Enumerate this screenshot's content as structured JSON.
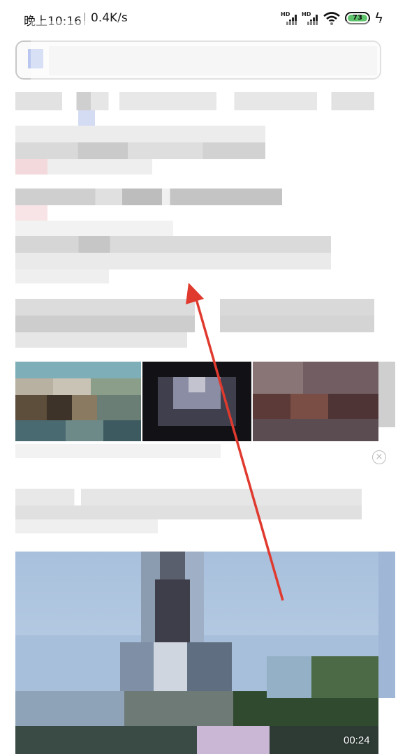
{
  "status_bar": {
    "time": "晚上10:16",
    "network_speed": "0.4K/s",
    "signal_label_1": "HD",
    "signal_label_2": "HD",
    "battery_level": "73",
    "icons": [
      "signal-icon",
      "signal-icon",
      "wifi-icon",
      "battery-icon",
      "charging-icon"
    ]
  },
  "search": {
    "icon": "back-icon"
  },
  "feed": {
    "close_symbol": "×",
    "video_duration": "00:24"
  },
  "colors": {
    "battery_fill": "#5ec46b",
    "annotation_arrow": "#e03a2f"
  }
}
